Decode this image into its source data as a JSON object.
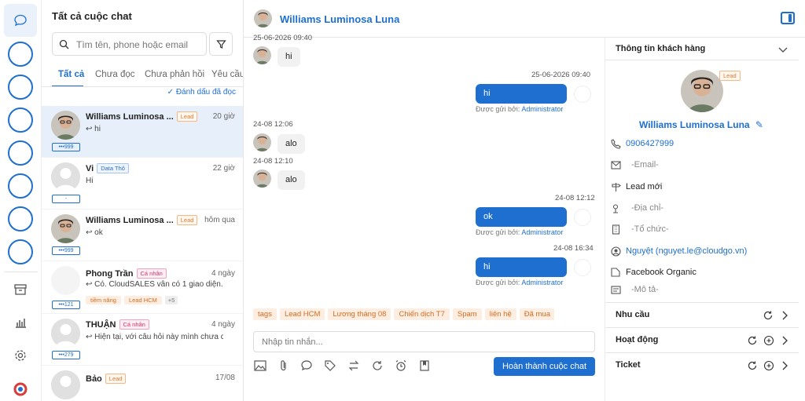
{
  "list": {
    "title": "Tất cả cuộc chat",
    "search_placeholder": "Tìm tên, phone hoặc email",
    "tabs": [
      "Tất cả",
      "Chưa đọc",
      "Chưa phản hồi",
      "Yêu cầu h"
    ],
    "mark_read": "Đánh dấu đã đọc",
    "conversations": [
      {
        "name": "Williams Luminosa ...",
        "badge": "Lead",
        "time": "20 giờ",
        "message": "hi",
        "id": "•••999"
      },
      {
        "name": "Vi",
        "badge": "Data Thô",
        "time": "22 giờ",
        "message": "Hi",
        "id": "-"
      },
      {
        "name": "Williams Luminosa ...",
        "badge": "Lead",
        "time": "hôm qua",
        "message": "ok",
        "id": "•••999"
      },
      {
        "name": "Phong Trần",
        "badge": "Cá nhân",
        "time": "4 ngày",
        "message": "Có. CloudSALES vẫn có 1 giao diện...",
        "id": "•••121",
        "tags": [
          "tiềm năng",
          "Lead HCM",
          "+5"
        ]
      },
      {
        "name": "THUẬN",
        "badge": "Cá nhân",
        "time": "4 ngày",
        "message": "Hiện tại, với câu hỏi này mình chưa c...",
        "id": "•••279"
      },
      {
        "name": "Bảo",
        "badge": "Lead",
        "time": "17/08",
        "message": "",
        "id": ""
      }
    ]
  },
  "chat": {
    "contact_name": "Williams Luminosa Luna",
    "messages": {
      "stamp_top": "25-06-2026 09:40",
      "in1": "hi",
      "stamp_out1": "25-06-2026 09:40",
      "out1": "hi",
      "sentby_label": "Được gửi bởi:",
      "sentby_name": "Administrator",
      "stamp_in2": "24-08 12:06",
      "in2": "alo",
      "stamp_in3": "24-08 12:10",
      "in3": "alo",
      "stamp_out2": "24-08 12:12",
      "out2": "ok",
      "stamp_out3": "24-08 16:34",
      "out3": "hi"
    },
    "tags": [
      "tags",
      "Lead HCM",
      "Lương tháng 08",
      "Chiến dịch T7",
      "Spam",
      "liên hệ",
      "Đã mua"
    ],
    "input_placeholder": "Nhập tin nhắn...",
    "done_button": "Hoàn thành cuộc chat"
  },
  "info": {
    "title": "Thông tin khách hàng",
    "badge": "Lead",
    "name": "Williams Luminosa Luna",
    "phone": "0906427999",
    "email": "-Email-",
    "status": "Lead mới",
    "address": "-Địa chỉ-",
    "org": "-Tổ chức-",
    "owner": "Nguyệt (nguyet.le@cloudgo.vn)",
    "source": "Facebook Organic",
    "description": "-Mô tả-",
    "sections": [
      "Nhu cầu",
      "Hoạt động",
      "Ticket"
    ]
  },
  "colors": {
    "accent": "#1e6fd0",
    "lead": "#e07a2e",
    "tag_bg": "#fdeee1"
  }
}
